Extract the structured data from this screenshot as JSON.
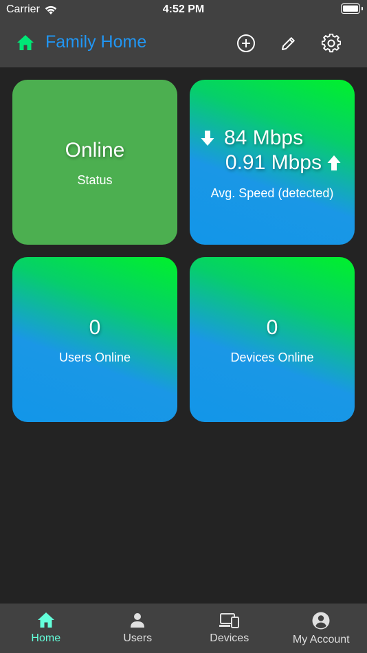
{
  "status_bar": {
    "carrier": "Carrier",
    "time": "4:52 PM"
  },
  "header": {
    "title": "Family Home",
    "accent_color": "#2196f3",
    "home_icon_color": "#00e676"
  },
  "tiles": {
    "status": {
      "value": "Online",
      "label": "Status",
      "color": "#4caf50"
    },
    "speed": {
      "download": "84 Mbps",
      "upload": "0.91 Mbps",
      "label": "Avg. Speed (detected)"
    },
    "users": {
      "value": "0",
      "label": "Users Online"
    },
    "devices": {
      "value": "0",
      "label": "Devices Online"
    }
  },
  "tabbar": {
    "active_color": "#64ffda",
    "items": [
      {
        "label": "Home",
        "icon": "home-icon",
        "active": true
      },
      {
        "label": "Users",
        "icon": "person-icon",
        "active": false
      },
      {
        "label": "Devices",
        "icon": "devices-icon",
        "active": false
      },
      {
        "label": "My Account",
        "icon": "account-circle-icon",
        "active": false
      }
    ]
  }
}
